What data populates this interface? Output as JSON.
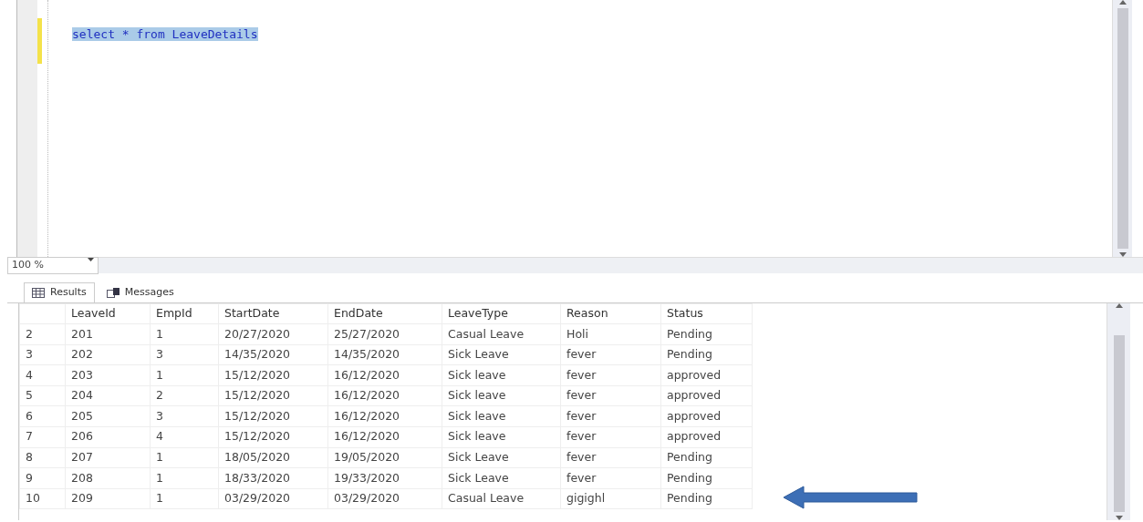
{
  "editor": {
    "query_line": "select * from LeaveDetails",
    "query_selected": true
  },
  "zoom": {
    "value": "100 %"
  },
  "tabs": [
    {
      "label": "Results",
      "selected": true,
      "kind": "grid"
    },
    {
      "label": "Messages",
      "selected": false,
      "kind": "messages"
    }
  ],
  "table": {
    "columns": [
      "",
      "LeaveId",
      "EmpId",
      "StartDate",
      "EndDate",
      "LeaveType",
      "Reason",
      "Status"
    ],
    "rows": [
      [
        "2",
        "201",
        "1",
        "20/27/2020",
        "25/27/2020",
        "Casual Leave",
        "Holi",
        "Pending"
      ],
      [
        "3",
        "202",
        "3",
        "14/35/2020",
        "14/35/2020",
        "Sick Leave",
        "fever",
        "Pending"
      ],
      [
        "4",
        "203",
        "1",
        "15/12/2020",
        "16/12/2020",
        "Sick leave",
        "fever",
        "approved"
      ],
      [
        "5",
        "204",
        "2",
        "15/12/2020",
        "16/12/2020",
        "Sick leave",
        "fever",
        "approved"
      ],
      [
        "6",
        "205",
        "3",
        "15/12/2020",
        "16/12/2020",
        "Sick leave",
        "fever",
        "approved"
      ],
      [
        "7",
        "206",
        "4",
        "15/12/2020",
        "16/12/2020",
        "Sick leave",
        "fever",
        "approved"
      ],
      [
        "8",
        "207",
        "1",
        "18/05/2020",
        "19/05/2020",
        "Sick Leave",
        "fever",
        "Pending"
      ],
      [
        "9",
        "208",
        "1",
        "18/33/2020",
        "19/33/2020",
        "Sick Leave",
        "fever",
        "Pending"
      ],
      [
        "10",
        "209",
        "1",
        "03/29/2020",
        "03/29/2020",
        "Casual Leave",
        "gigighl",
        "Pending"
      ]
    ]
  }
}
